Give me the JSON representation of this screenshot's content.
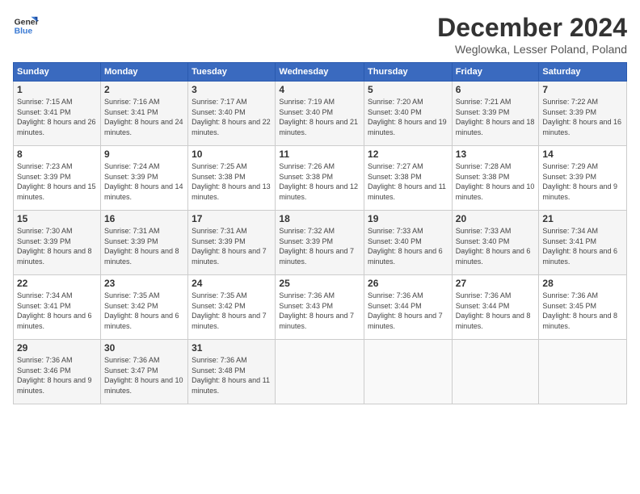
{
  "header": {
    "logo_line1": "General",
    "logo_line2": "Blue",
    "month": "December 2024",
    "location": "Weglowka, Lesser Poland, Poland"
  },
  "days_of_week": [
    "Sunday",
    "Monday",
    "Tuesday",
    "Wednesday",
    "Thursday",
    "Friday",
    "Saturday"
  ],
  "weeks": [
    [
      {
        "day": "1",
        "sunrise": "Sunrise: 7:15 AM",
        "sunset": "Sunset: 3:41 PM",
        "daylight": "Daylight: 8 hours and 26 minutes."
      },
      {
        "day": "2",
        "sunrise": "Sunrise: 7:16 AM",
        "sunset": "Sunset: 3:41 PM",
        "daylight": "Daylight: 8 hours and 24 minutes."
      },
      {
        "day": "3",
        "sunrise": "Sunrise: 7:17 AM",
        "sunset": "Sunset: 3:40 PM",
        "daylight": "Daylight: 8 hours and 22 minutes."
      },
      {
        "day": "4",
        "sunrise": "Sunrise: 7:19 AM",
        "sunset": "Sunset: 3:40 PM",
        "daylight": "Daylight: 8 hours and 21 minutes."
      },
      {
        "day": "5",
        "sunrise": "Sunrise: 7:20 AM",
        "sunset": "Sunset: 3:40 PM",
        "daylight": "Daylight: 8 hours and 19 minutes."
      },
      {
        "day": "6",
        "sunrise": "Sunrise: 7:21 AM",
        "sunset": "Sunset: 3:39 PM",
        "daylight": "Daylight: 8 hours and 18 minutes."
      },
      {
        "day": "7",
        "sunrise": "Sunrise: 7:22 AM",
        "sunset": "Sunset: 3:39 PM",
        "daylight": "Daylight: 8 hours and 16 minutes."
      }
    ],
    [
      {
        "day": "8",
        "sunrise": "Sunrise: 7:23 AM",
        "sunset": "Sunset: 3:39 PM",
        "daylight": "Daylight: 8 hours and 15 minutes."
      },
      {
        "day": "9",
        "sunrise": "Sunrise: 7:24 AM",
        "sunset": "Sunset: 3:39 PM",
        "daylight": "Daylight: 8 hours and 14 minutes."
      },
      {
        "day": "10",
        "sunrise": "Sunrise: 7:25 AM",
        "sunset": "Sunset: 3:38 PM",
        "daylight": "Daylight: 8 hours and 13 minutes."
      },
      {
        "day": "11",
        "sunrise": "Sunrise: 7:26 AM",
        "sunset": "Sunset: 3:38 PM",
        "daylight": "Daylight: 8 hours and 12 minutes."
      },
      {
        "day": "12",
        "sunrise": "Sunrise: 7:27 AM",
        "sunset": "Sunset: 3:38 PM",
        "daylight": "Daylight: 8 hours and 11 minutes."
      },
      {
        "day": "13",
        "sunrise": "Sunrise: 7:28 AM",
        "sunset": "Sunset: 3:38 PM",
        "daylight": "Daylight: 8 hours and 10 minutes."
      },
      {
        "day": "14",
        "sunrise": "Sunrise: 7:29 AM",
        "sunset": "Sunset: 3:39 PM",
        "daylight": "Daylight: 8 hours and 9 minutes."
      }
    ],
    [
      {
        "day": "15",
        "sunrise": "Sunrise: 7:30 AM",
        "sunset": "Sunset: 3:39 PM",
        "daylight": "Daylight: 8 hours and 8 minutes."
      },
      {
        "day": "16",
        "sunrise": "Sunrise: 7:31 AM",
        "sunset": "Sunset: 3:39 PM",
        "daylight": "Daylight: 8 hours and 8 minutes."
      },
      {
        "day": "17",
        "sunrise": "Sunrise: 7:31 AM",
        "sunset": "Sunset: 3:39 PM",
        "daylight": "Daylight: 8 hours and 7 minutes."
      },
      {
        "day": "18",
        "sunrise": "Sunrise: 7:32 AM",
        "sunset": "Sunset: 3:39 PM",
        "daylight": "Daylight: 8 hours and 7 minutes."
      },
      {
        "day": "19",
        "sunrise": "Sunrise: 7:33 AM",
        "sunset": "Sunset: 3:40 PM",
        "daylight": "Daylight: 8 hours and 6 minutes."
      },
      {
        "day": "20",
        "sunrise": "Sunrise: 7:33 AM",
        "sunset": "Sunset: 3:40 PM",
        "daylight": "Daylight: 8 hours and 6 minutes."
      },
      {
        "day": "21",
        "sunrise": "Sunrise: 7:34 AM",
        "sunset": "Sunset: 3:41 PM",
        "daylight": "Daylight: 8 hours and 6 minutes."
      }
    ],
    [
      {
        "day": "22",
        "sunrise": "Sunrise: 7:34 AM",
        "sunset": "Sunset: 3:41 PM",
        "daylight": "Daylight: 8 hours and 6 minutes."
      },
      {
        "day": "23",
        "sunrise": "Sunrise: 7:35 AM",
        "sunset": "Sunset: 3:42 PM",
        "daylight": "Daylight: 8 hours and 6 minutes."
      },
      {
        "day": "24",
        "sunrise": "Sunrise: 7:35 AM",
        "sunset": "Sunset: 3:42 PM",
        "daylight": "Daylight: 8 hours and 7 minutes."
      },
      {
        "day": "25",
        "sunrise": "Sunrise: 7:36 AM",
        "sunset": "Sunset: 3:43 PM",
        "daylight": "Daylight: 8 hours and 7 minutes."
      },
      {
        "day": "26",
        "sunrise": "Sunrise: 7:36 AM",
        "sunset": "Sunset: 3:44 PM",
        "daylight": "Daylight: 8 hours and 7 minutes."
      },
      {
        "day": "27",
        "sunrise": "Sunrise: 7:36 AM",
        "sunset": "Sunset: 3:44 PM",
        "daylight": "Daylight: 8 hours and 8 minutes."
      },
      {
        "day": "28",
        "sunrise": "Sunrise: 7:36 AM",
        "sunset": "Sunset: 3:45 PM",
        "daylight": "Daylight: 8 hours and 8 minutes."
      }
    ],
    [
      {
        "day": "29",
        "sunrise": "Sunrise: 7:36 AM",
        "sunset": "Sunset: 3:46 PM",
        "daylight": "Daylight: 8 hours and 9 minutes."
      },
      {
        "day": "30",
        "sunrise": "Sunrise: 7:36 AM",
        "sunset": "Sunset: 3:47 PM",
        "daylight": "Daylight: 8 hours and 10 minutes."
      },
      {
        "day": "31",
        "sunrise": "Sunrise: 7:36 AM",
        "sunset": "Sunset: 3:48 PM",
        "daylight": "Daylight: 8 hours and 11 minutes."
      },
      null,
      null,
      null,
      null
    ]
  ]
}
